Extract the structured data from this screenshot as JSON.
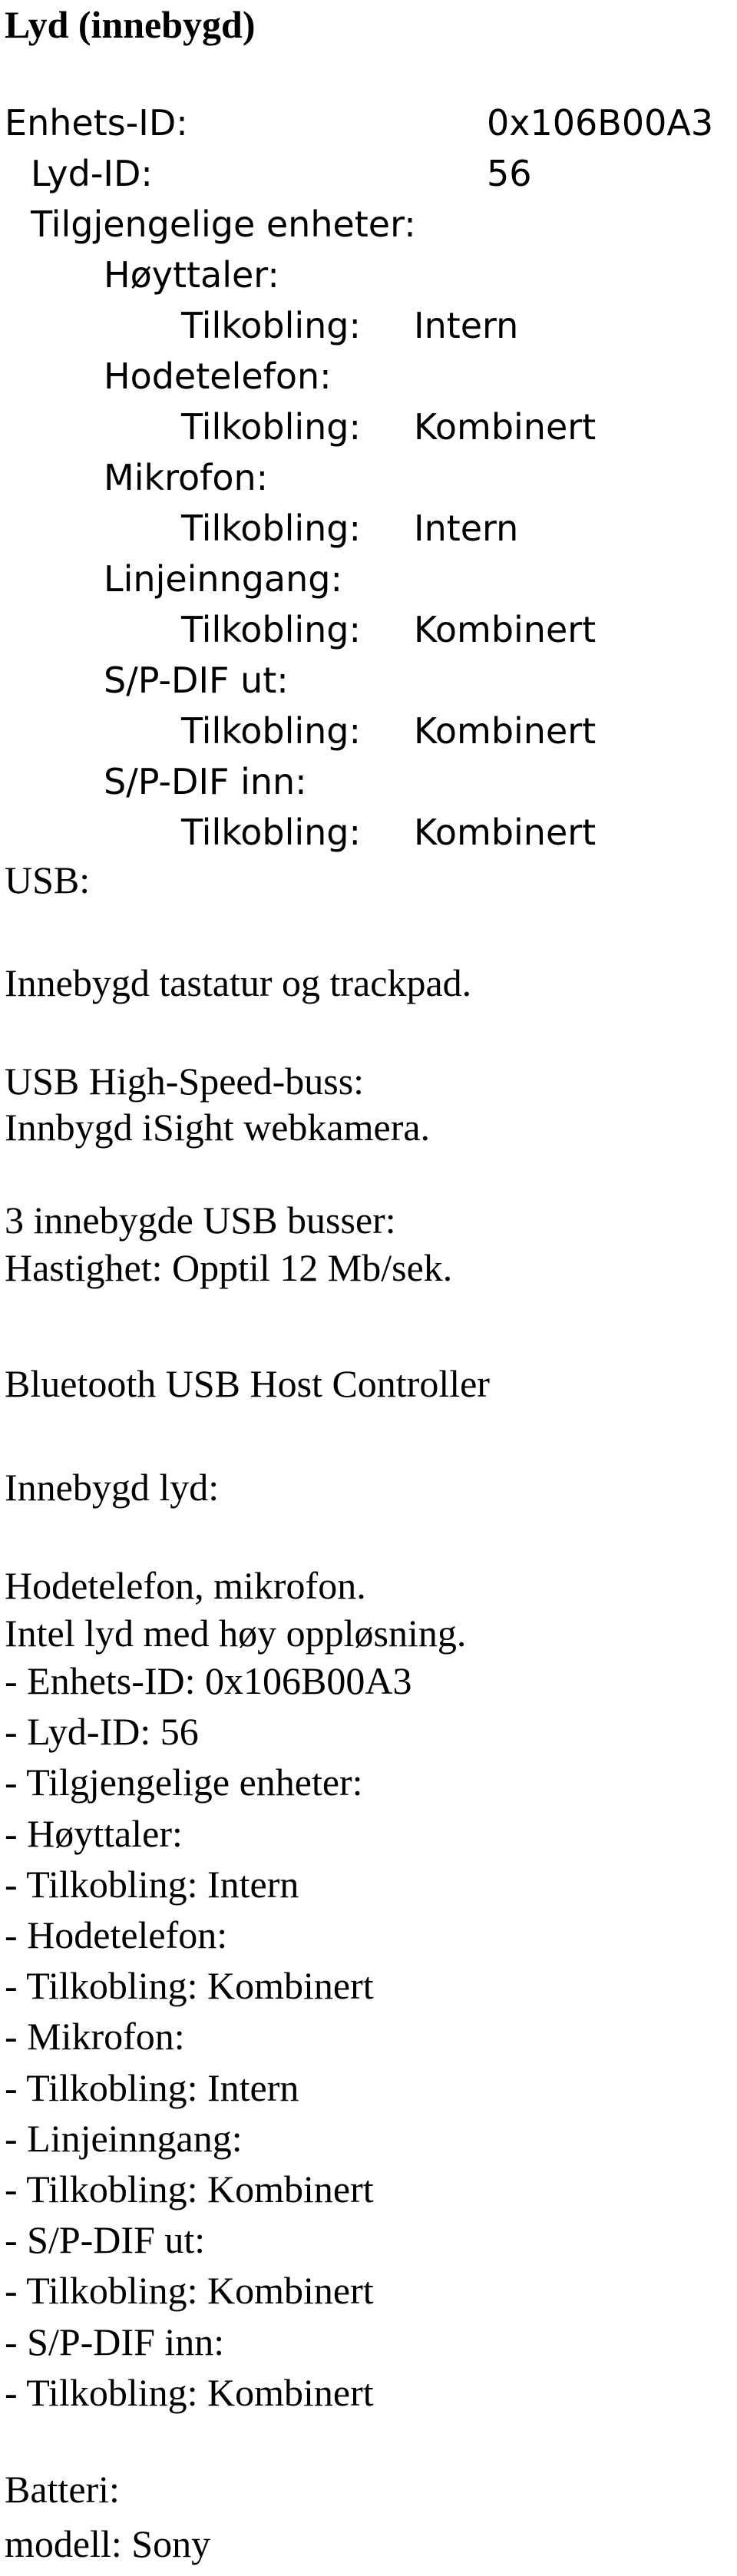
{
  "title": "Lyd (innebygd)",
  "audio": {
    "device_id_label": "Enhets-ID:",
    "device_id_value": "0x106B00A3",
    "audio_id_label": "Lyd-ID:",
    "audio_id_value": "56",
    "available_label": "Tilgjengelige enheter:",
    "devices": [
      {
        "name": "Høyttaler:",
        "conn_label": "Tilkobling:",
        "conn_value": "Intern"
      },
      {
        "name": "Hodetelefon:",
        "conn_label": "Tilkobling:",
        "conn_value": "Kombinert"
      },
      {
        "name": "Mikrofon:",
        "conn_label": "Tilkobling:",
        "conn_value": "Intern"
      },
      {
        "name": "Linjeinngang:",
        "conn_label": "Tilkobling:",
        "conn_value": "Kombinert"
      },
      {
        "name": "S/P-DIF ut:",
        "conn_label": "Tilkobling:",
        "conn_value": "Kombinert"
      },
      {
        "name": "S/P-DIF inn:",
        "conn_label": "Tilkobling:",
        "conn_value": "Kombinert"
      }
    ]
  },
  "usb": {
    "heading": "USB:",
    "lines": [
      "Innebygd tastatur og trackpad.",
      "USB High-Speed-buss:",
      "Innbygd iSight webkamera.",
      "3 innebygde USB busser:",
      "Hastighet: Opptil 12 Mb/sek.",
      "Bluetooth USB Host Controller",
      "Innebygd lyd:",
      "Hodetelefon, mikrofon.",
      "Intel lyd med høy oppløsning."
    ]
  },
  "list": [
    "- Enhets-ID: 0x106B00A3",
    "- Lyd-ID: 56",
    "- Tilgjengelige enheter:",
    "- Høyttaler:",
    "- Tilkobling: Intern",
    "- Hodetelefon:",
    "- Tilkobling: Kombinert",
    "- Mikrofon:",
    "- Tilkobling: Intern",
    "- Linjeinngang:",
    "- Tilkobling: Kombinert",
    "- S/P-DIF ut:",
    "- Tilkobling: Kombinert",
    "- S/P-DIF inn:",
    "- Tilkobling: Kombinert"
  ],
  "battery": {
    "heading": "Batteri:",
    "model": "modell: Sony"
  }
}
